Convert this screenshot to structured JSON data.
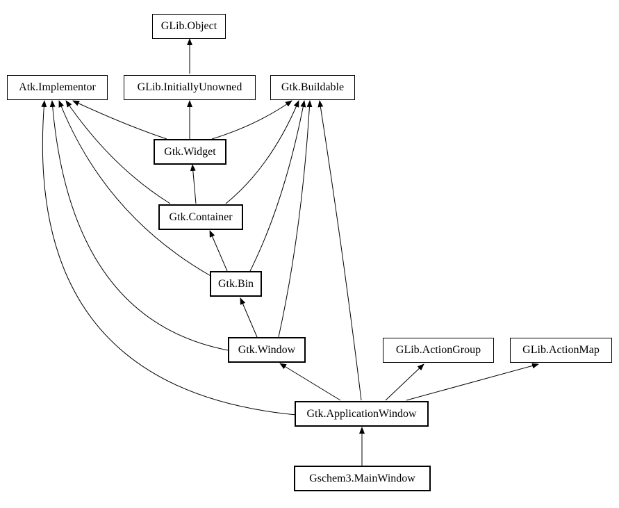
{
  "chart_data": {
    "type": "graph",
    "nodes": [
      {
        "id": "glib_object",
        "label": "GLib.Object"
      },
      {
        "id": "atk_implementor",
        "label": "Atk.Implementor"
      },
      {
        "id": "glib_initiallyunowned",
        "label": "GLib.InitiallyUnowned"
      },
      {
        "id": "gtk_buildable",
        "label": "Gtk.Buildable"
      },
      {
        "id": "gtk_widget",
        "label": "Gtk.Widget"
      },
      {
        "id": "gtk_container",
        "label": "Gtk.Container"
      },
      {
        "id": "gtk_bin",
        "label": "Gtk.Bin"
      },
      {
        "id": "gtk_window",
        "label": "Gtk.Window"
      },
      {
        "id": "glib_actiongroup",
        "label": "GLib.ActionGroup"
      },
      {
        "id": "glib_actionmap",
        "label": "GLib.ActionMap"
      },
      {
        "id": "gtk_applicationwindow",
        "label": "Gtk.ApplicationWindow"
      },
      {
        "id": "gschem3_mainwindow",
        "label": "Gschem3.MainWindow"
      }
    ],
    "edges": [
      {
        "from": "glib_initiallyunowned",
        "to": "glib_object"
      },
      {
        "from": "gtk_widget",
        "to": "glib_initiallyunowned"
      },
      {
        "from": "gtk_widget",
        "to": "atk_implementor"
      },
      {
        "from": "gtk_widget",
        "to": "gtk_buildable"
      },
      {
        "from": "gtk_container",
        "to": "gtk_widget"
      },
      {
        "from": "gtk_container",
        "to": "atk_implementor"
      },
      {
        "from": "gtk_container",
        "to": "gtk_buildable"
      },
      {
        "from": "gtk_bin",
        "to": "gtk_container"
      },
      {
        "from": "gtk_bin",
        "to": "atk_implementor"
      },
      {
        "from": "gtk_bin",
        "to": "gtk_buildable"
      },
      {
        "from": "gtk_window",
        "to": "gtk_bin"
      },
      {
        "from": "gtk_window",
        "to": "atk_implementor"
      },
      {
        "from": "gtk_window",
        "to": "gtk_buildable"
      },
      {
        "from": "gtk_applicationwindow",
        "to": "gtk_window"
      },
      {
        "from": "gtk_applicationwindow",
        "to": "atk_implementor"
      },
      {
        "from": "gtk_applicationwindow",
        "to": "gtk_buildable"
      },
      {
        "from": "gtk_applicationwindow",
        "to": "glib_actiongroup"
      },
      {
        "from": "gtk_applicationwindow",
        "to": "glib_actionmap"
      },
      {
        "from": "gschem3_mainwindow",
        "to": "gtk_applicationwindow"
      }
    ]
  }
}
